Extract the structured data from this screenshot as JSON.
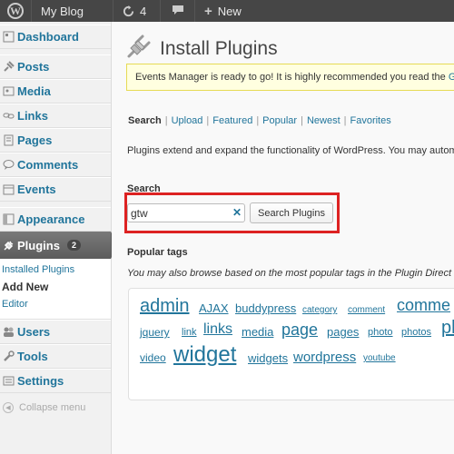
{
  "admin_bar": {
    "logo_icon": "wordpress-logo-icon",
    "site_name": "My Blog",
    "updates_count": "4",
    "updates_icon": "refresh-icon",
    "comments_icon": "comment-bubble-icon",
    "new_label": "New",
    "new_icon": "plus-icon"
  },
  "sidebar": {
    "items": [
      {
        "label": "Dashboard",
        "icon": "dashboard-icon"
      },
      {
        "label": "Posts",
        "icon": "pin-icon"
      },
      {
        "label": "Media",
        "icon": "media-icon"
      },
      {
        "label": "Links",
        "icon": "links-icon"
      },
      {
        "label": "Pages",
        "icon": "page-icon"
      },
      {
        "label": "Comments",
        "icon": "comments-icon"
      },
      {
        "label": "Events",
        "icon": "calendar-icon"
      },
      {
        "label": "Appearance",
        "icon": "appearance-icon"
      },
      {
        "label": "Plugins",
        "icon": "plug-icon",
        "badge": "2"
      },
      {
        "label": "Users",
        "icon": "users-icon"
      },
      {
        "label": "Tools",
        "icon": "tools-icon"
      },
      {
        "label": "Settings",
        "icon": "settings-icon"
      }
    ],
    "plugins_submenu": [
      "Installed Plugins",
      "Add New",
      "Editor"
    ],
    "collapse_label": "Collapse menu"
  },
  "main": {
    "title": "Install Plugins",
    "title_icon": "plugin-plug-icon",
    "notice": {
      "text": "Events Manager is ready to go! It is highly recommended you read the ",
      "link": "Ge"
    },
    "tabs": [
      "Search",
      "Upload",
      "Featured",
      "Popular",
      "Newest",
      "Favorites"
    ],
    "description": "Plugins extend and expand the functionality of WordPress. You may autom",
    "search": {
      "label": "Search",
      "value": "gtw",
      "button": "Search Plugins"
    },
    "popular": {
      "label": "Popular tags",
      "description": "You may also browse based on the most popular tags in the Plugin Direct",
      "tags": [
        "admin",
        "AJAX",
        "buddypress",
        "category",
        "comment",
        "comme",
        "jquery",
        "link",
        "links",
        "media",
        "page",
        "pages",
        "photo",
        "photos",
        "pl",
        "video",
        "widget",
        "widgets",
        "wordpress",
        "youtube"
      ]
    }
  },
  "colors": {
    "admin_bar": "#464646",
    "link": "#21759b",
    "highlight_box": "#dd2222",
    "notice_bg": "#ffffe0"
  }
}
